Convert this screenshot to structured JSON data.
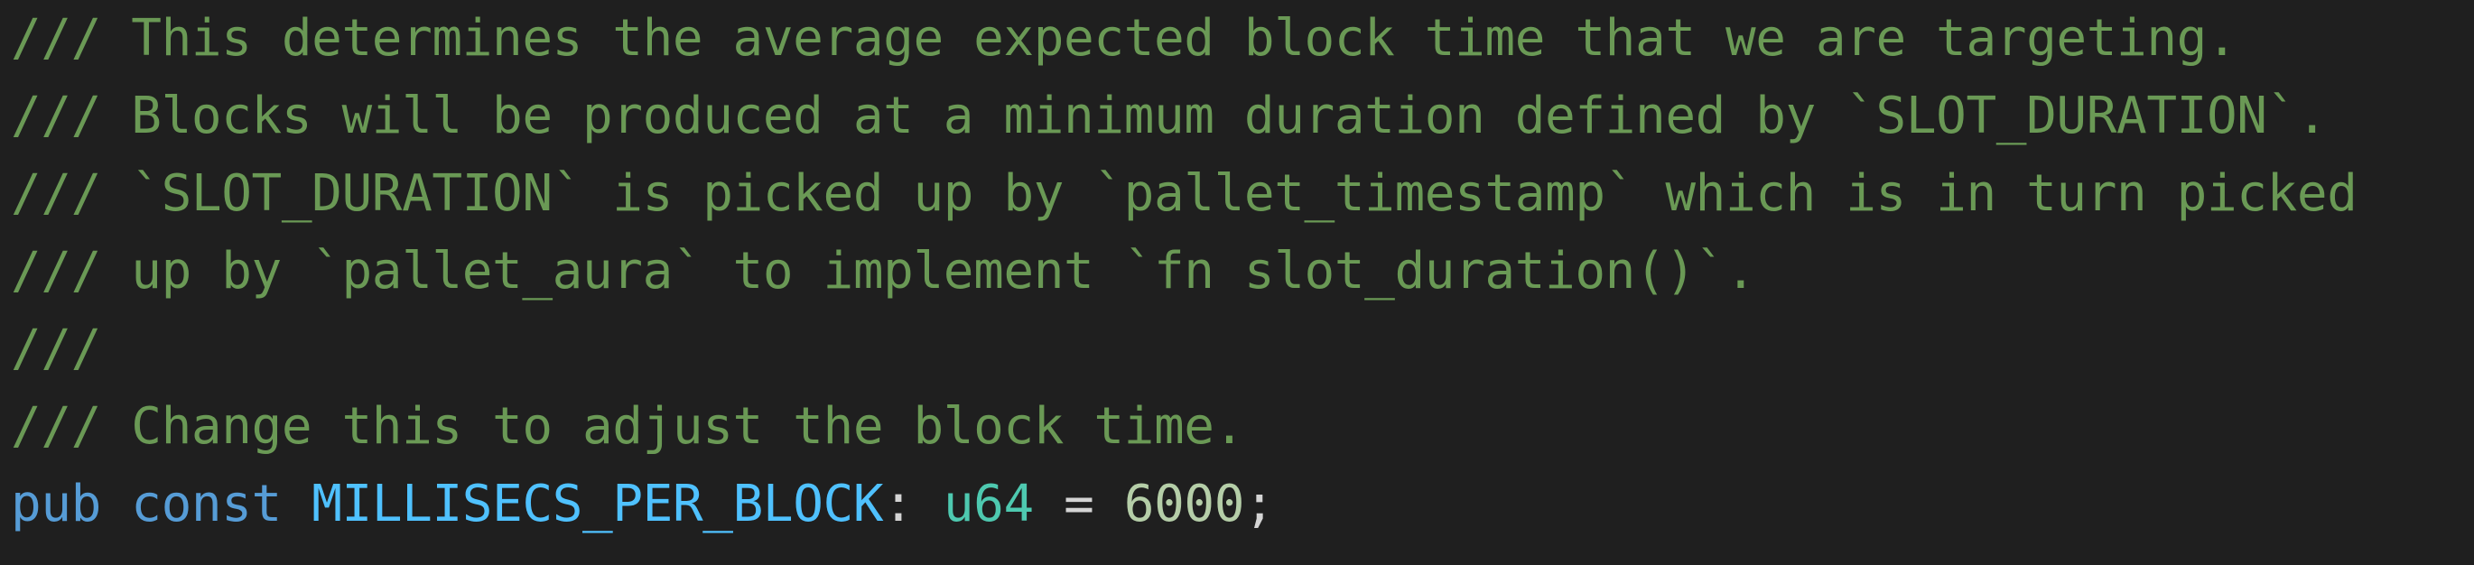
{
  "code_editor": {
    "language": "rust",
    "lines": [
      {
        "text": "/// This determines the average expected block time that we are targeting."
      },
      {
        "text": "/// Blocks will be produced at a minimum duration defined by `SLOT_DURATION`."
      },
      {
        "text": "/// `SLOT_DURATION` is picked up by `pallet_timestamp` which is in turn picked"
      },
      {
        "text": "/// up by `pallet_aura` to implement `fn slot_duration()`."
      },
      {
        "text": "///"
      },
      {
        "text": "/// Change this to adjust the block time."
      },
      {
        "tokens": {
          "keyword_pub": "pub",
          "keyword_const": "const",
          "identifier": "MILLISECS_PER_BLOCK",
          "colon": ":",
          "type": "u64",
          "equals": "=",
          "value": "6000",
          "semicolon": ";"
        }
      }
    ]
  },
  "colors": {
    "background": "#1f1f1f",
    "comment": "#6a9955",
    "keyword": "#569cd6",
    "constant": "#4fc1ff",
    "type": "#4ec9b0",
    "number": "#b5cea8",
    "punctuation": "#d4d4d4"
  }
}
